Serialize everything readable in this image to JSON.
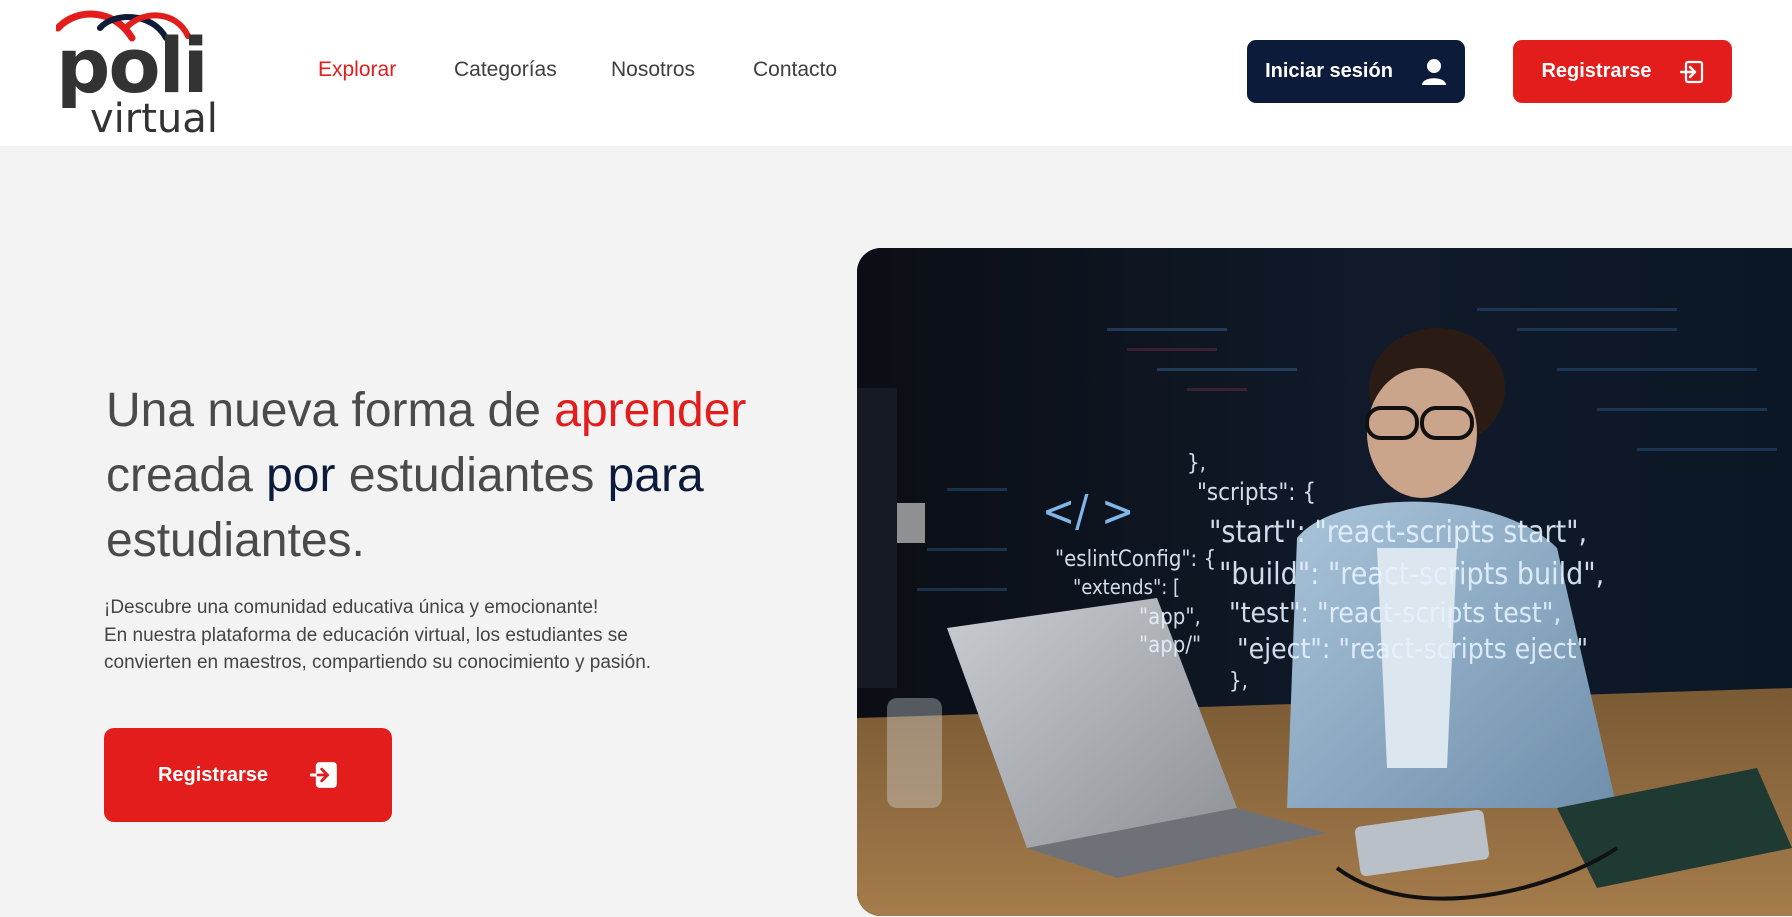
{
  "logo": {
    "brand_top": "poli",
    "brand_bottom": "virtual"
  },
  "nav": {
    "items": [
      {
        "label": "Explorar",
        "active": true
      },
      {
        "label": "Categorías",
        "active": false
      },
      {
        "label": "Nosotros",
        "active": false
      },
      {
        "label": "Contacto",
        "active": false
      }
    ]
  },
  "header_actions": {
    "login_label": "Iniciar sesión",
    "login_icon": "user-icon",
    "register_label": "Registrarse",
    "register_icon": "sign-in-icon"
  },
  "hero": {
    "title_parts": {
      "p1": "Una nueva forma de ",
      "p2": "aprender",
      "p3": "creada ",
      "p4": "por",
      "p5": " estudiantes ",
      "p6": "para",
      "p7": "estudiantes."
    },
    "description_lines": [
      "¡Descubre una comunidad educativa única y emocionante!",
      "En nuestra plataforma de educación virtual, los estudiantes se",
      "convierten en maestros, compartiendo su conocimiento y pasión."
    ],
    "cta_label": "Registrarse"
  },
  "image": {
    "code_lines": [
      "},",
      "\"scripts\": {",
      "\"start\": \"react-scripts start\",",
      "\"build\": \"react-scripts build\",",
      "\"test\": \"react-scripts test\",",
      "\"eject\": \"react-scripts eject\"",
      "},",
      "\"eslintConfig\": {",
      "\"extends\": [",
      "\"app\",",
      "\"app/\"",
      "</ >"
    ]
  },
  "colors": {
    "accent_red": "#e31c1c",
    "navy": "#0d1b3a",
    "background": "#f3f3f3",
    "header_bg": "#ffffff"
  }
}
